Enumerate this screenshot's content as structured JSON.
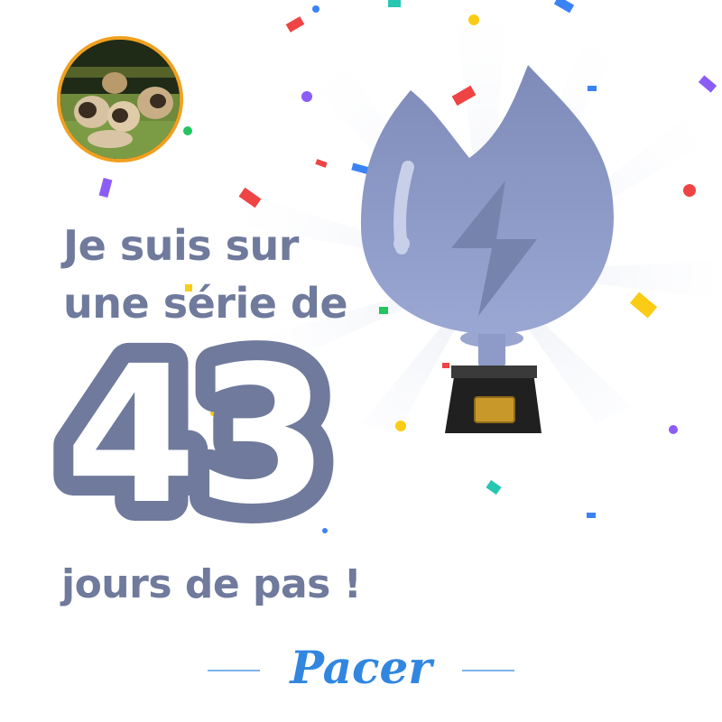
{
  "headline": {
    "line1": "Je suis sur",
    "line2": "une série de"
  },
  "streak": {
    "count": "43",
    "suffix": "jours de pas !"
  },
  "brand": {
    "name": "Pacer"
  },
  "colors": {
    "text": "#6f7a9c",
    "trophy": "#8e9bc8",
    "brand": "#3187e0",
    "avatar_ring": "#f0a020"
  },
  "icons": {
    "trophy": "flame-trophy-icon",
    "avatar": "profile-photo-dogs"
  }
}
